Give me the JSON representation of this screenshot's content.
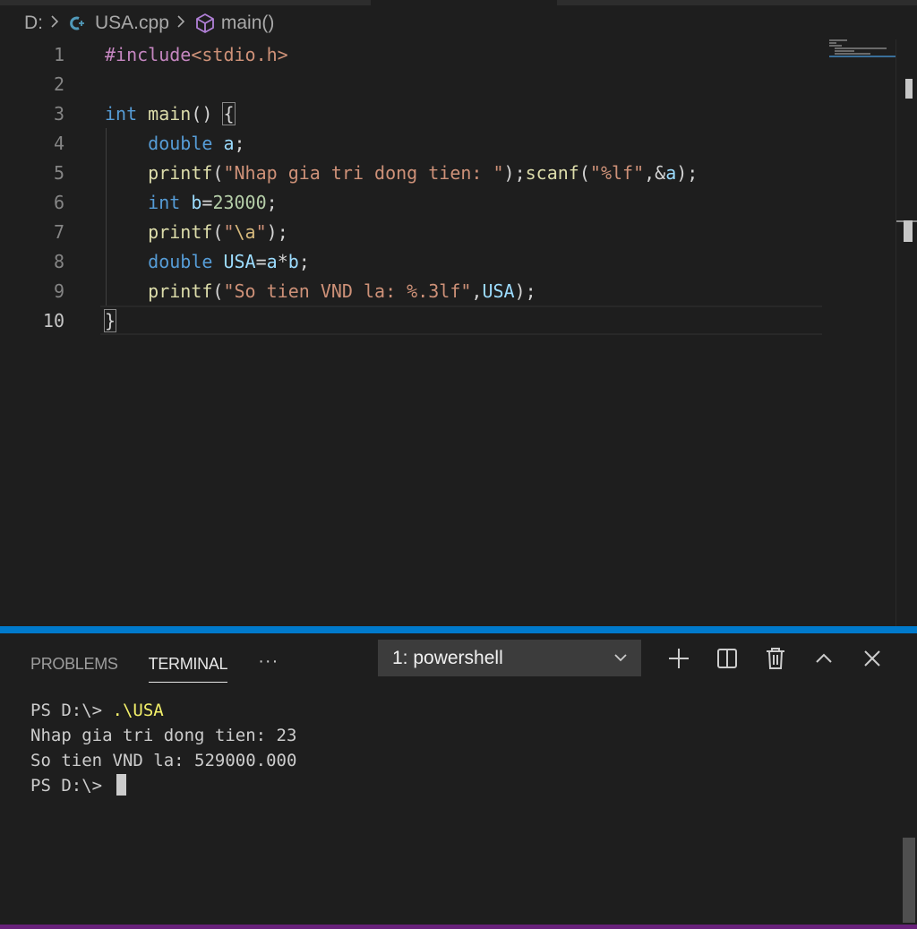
{
  "breadcrumb": {
    "drive": "D:",
    "file": "USA.cpp",
    "symbol": "main()"
  },
  "editor": {
    "active_line": 10,
    "lines": [
      {
        "num": "1"
      },
      {
        "num": "2"
      },
      {
        "num": "3"
      },
      {
        "num": "4"
      },
      {
        "num": "5"
      },
      {
        "num": "6"
      },
      {
        "num": "7"
      },
      {
        "num": "8"
      },
      {
        "num": "9"
      },
      {
        "num": "10"
      }
    ],
    "code": {
      "l1_include": "#include",
      "l1_header": "<stdio.h>",
      "l3_int": "int",
      "l3_main": "main",
      "l3_rest": "() ",
      "l3_brace": "{",
      "l4_type": "double",
      "l4_var": "a",
      "l4_end": ";",
      "l5_printf": "printf",
      "l5_open": "(",
      "l5_str": "\"Nhap gia tri dong tien: \"",
      "l5_mid": ");",
      "l5_scanf": "scanf",
      "l5_open2": "(",
      "l5_fmt": "\"%lf\"",
      "l5_amp": ",&",
      "l5_var": "a",
      "l5_end": ");",
      "l6_type": "int",
      "l6_var": "b",
      "l6_eq": "=",
      "l6_num": "23000",
      "l6_end": ";",
      "l7_printf": "printf",
      "l7_open": "(",
      "l7_q1": "\"",
      "l7_esc": "\\a",
      "l7_q2": "\"",
      "l7_end": ");",
      "l8_type": "double",
      "l8_var": "USA",
      "l8_eq": "=",
      "l8_a": "a",
      "l8_op": "*",
      "l8_b": "b",
      "l8_end": ";",
      "l9_printf": "printf",
      "l9_open": "(",
      "l9_str": "\"So tien VND la: %.3lf\"",
      "l9_comma": ",",
      "l9_var": "USA",
      "l9_end": ");",
      "l10_brace": "}"
    }
  },
  "panel": {
    "tabs": [
      {
        "label": "PROBLEMS"
      },
      {
        "label": "TERMINAL"
      }
    ],
    "more": "···",
    "terminal_select": "1: powershell",
    "terminal_lines": {
      "l1_prompt": "PS D:\\> ",
      "l1_cmd": ".\\USA",
      "l2": "Nhap gia tri dong tien: 23",
      "l3": "So tien VND la: 529000.000",
      "l4_prompt": "PS D:\\> "
    }
  },
  "colors": {
    "accent": "#007acc",
    "status": "#68217a",
    "keyword": "#569cd6",
    "function": "#dcdcaa",
    "string": "#ce9178",
    "variable": "#9cdcfe",
    "number": "#b5cea8",
    "preprocessor": "#c586c0"
  },
  "icons": [
    "cpp-file-icon",
    "cube-icon",
    "chevron-right-icon",
    "chevron-down-icon",
    "plus-icon",
    "split-icon",
    "trash-icon",
    "chevron-up-icon",
    "close-icon"
  ]
}
